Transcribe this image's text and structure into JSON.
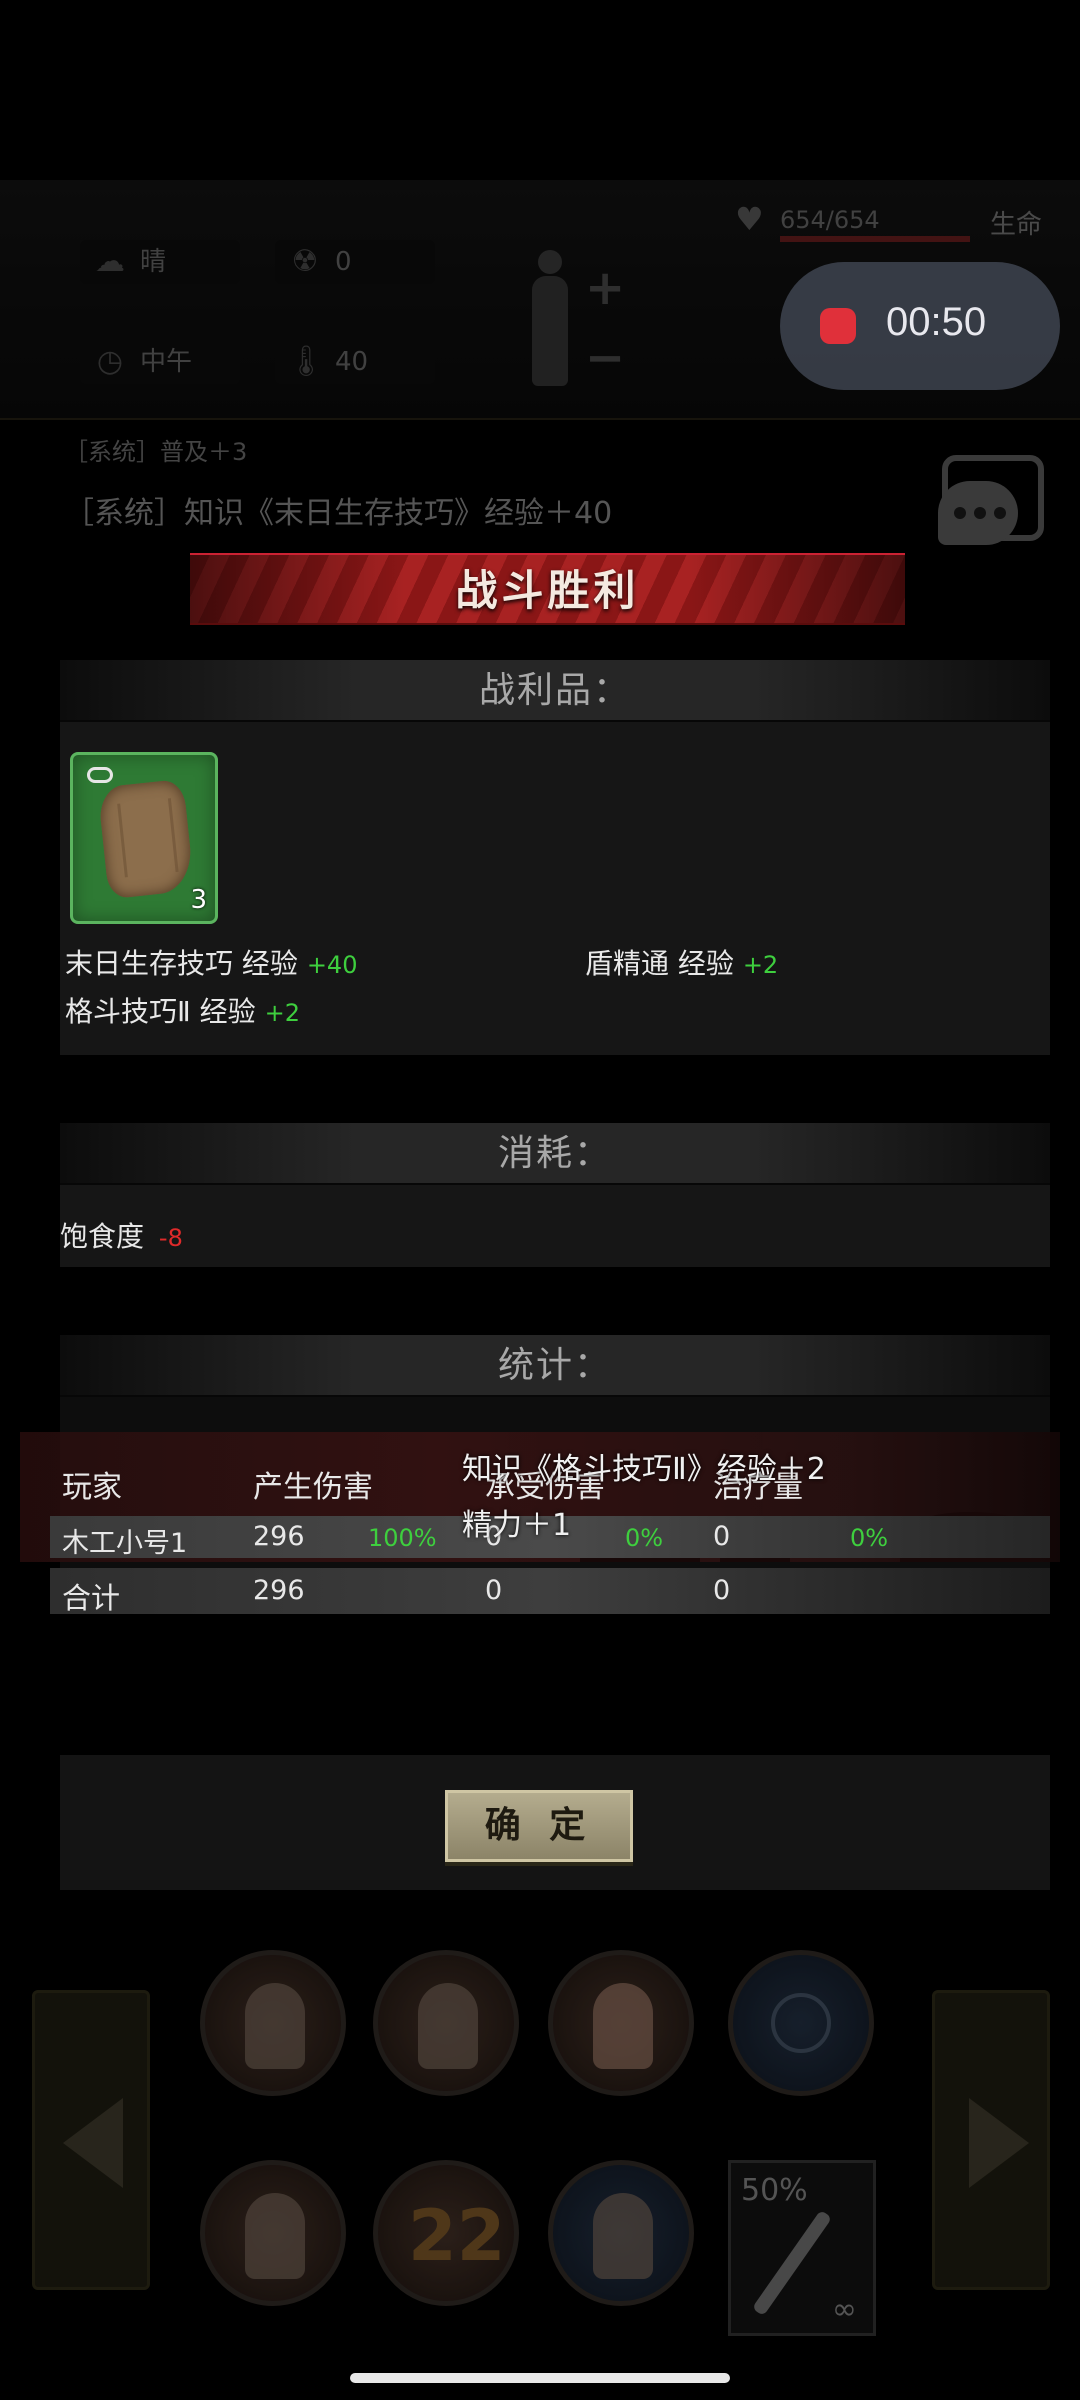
{
  "hud": {
    "weather": "晴",
    "radiation": "0",
    "time_of_day": "中午",
    "temperature": "40",
    "life_value": "654/654",
    "life_label": "生命"
  },
  "recording": {
    "time": "00:50"
  },
  "system_log": {
    "line1": "［系统］普及＋3",
    "line2": "［系统］知识《末日生存技巧》经验＋40"
  },
  "result": {
    "title": "战斗胜利",
    "loot_header": "战利品：",
    "loot_item": {
      "count": "3",
      "slot_color": "#2e7a34"
    },
    "exp_gains": [
      {
        "label": "末日生存技巧 经验",
        "value": "+40"
      },
      {
        "label": "盾精通 经验",
        "value": "+2"
      },
      {
        "label": "格斗技巧Ⅱ 经验",
        "value": "+2"
      }
    ],
    "consume_header": "消耗：",
    "consume": [
      {
        "label": "饱食度",
        "value": "-8"
      }
    ],
    "stats_header": "统计：",
    "stats_columns": [
      "玩家",
      "产生伤害",
      "承受伤害",
      "治疗量"
    ],
    "stats_rows": [
      {
        "name": "木工小号1",
        "damage": "296",
        "damage_pct": "100%",
        "taken": "0",
        "taken_pct": "0%",
        "heal": "0",
        "heal_pct": "0%"
      },
      {
        "name": "合计",
        "damage": "296",
        "taken": "0",
        "heal": "0"
      }
    ],
    "floating_messages": [
      "知识《格斗技巧Ⅱ》经验＋2",
      "精力＋1"
    ],
    "confirm_label": "确 定"
  },
  "action_bar": {
    "skill_number": "22",
    "weapon_durability": "50%",
    "weapon_ammo": "∞"
  },
  "colors": {
    "positive": "#3ecf3e",
    "negative": "#e02a2a",
    "banner": "#a82222",
    "record": "#e0303a"
  }
}
